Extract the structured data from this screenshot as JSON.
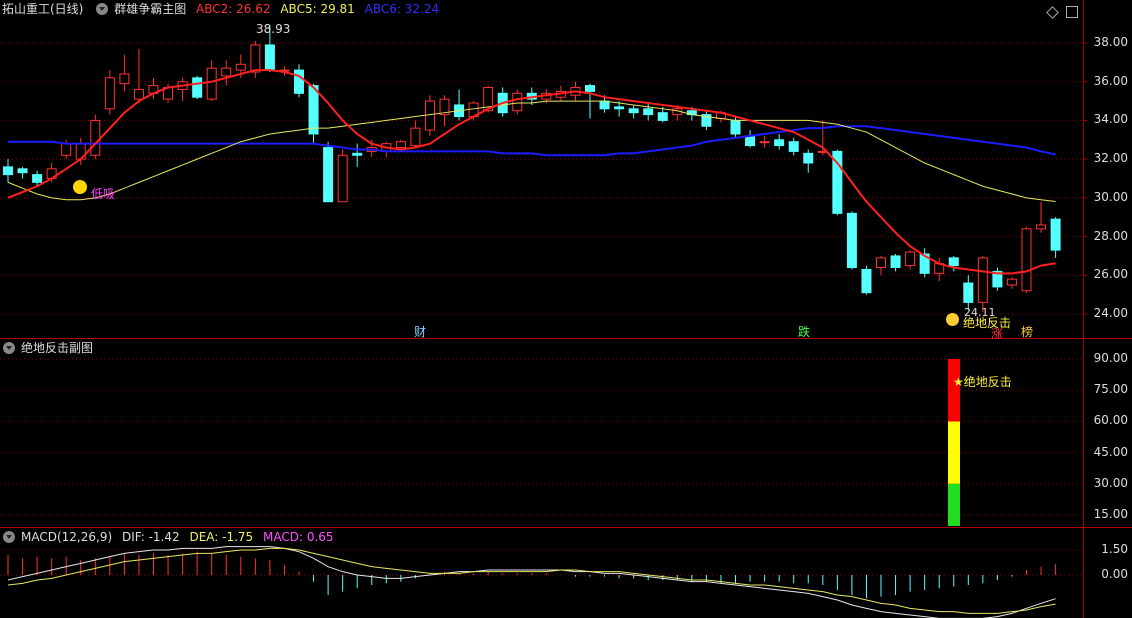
{
  "main": {
    "title": "拓山重工(日线)",
    "indicator": "群雄争霸主图",
    "abc2_label": "ABC2: 26.62",
    "abc5_label": "ABC5: 29.81",
    "abc6_label": "ABC6: 32.24",
    "high_mark": "38.93",
    "low_mark": "24.11",
    "dixi_label": "低吸",
    "juedi_label": "绝地反击",
    "cai_label": "财",
    "die_label": "跌",
    "zhang_label": "涨",
    "bang_label": "榜",
    "y_ticks": [
      "38.00",
      "36.00",
      "34.00",
      "32.00",
      "30.00",
      "28.00",
      "26.00",
      "24.00"
    ]
  },
  "sub": {
    "title": "绝地反击副图",
    "signal_label": "★绝地反击",
    "y_ticks": [
      "90.00",
      "75.00",
      "60.00",
      "45.00",
      "30.00",
      "15.00"
    ]
  },
  "macd": {
    "title": "MACD(12,26,9)",
    "dif": "DIF: -1.42",
    "dea": "DEA: -1.75",
    "macd": "MACD: 0.65",
    "y_ticks": [
      "1.50",
      "0.00"
    ]
  },
  "colors": {
    "up": "#ff3232",
    "down": "#54ffff",
    "abc2": "#ff2020",
    "abc5": "#e8e860",
    "abc6": "#1c1cff",
    "macd_label": "#ff50ff",
    "grid": "#8c0000"
  },
  "chart_data": {
    "type": "candlestick",
    "price_range": [
      23.4,
      39.8
    ],
    "candles": [
      [
        31.6,
        31.2,
        32.0,
        30.8
      ],
      [
        31.5,
        31.3,
        31.6,
        31.0
      ],
      [
        31.2,
        30.8,
        31.4,
        30.6
      ],
      [
        31.0,
        31.5,
        31.8,
        30.8
      ],
      [
        32.2,
        32.8,
        33.0,
        32.0
      ],
      [
        32.0,
        32.8,
        33.1,
        31.7
      ],
      [
        32.2,
        34.0,
        34.3,
        32.0
      ],
      [
        34.6,
        36.2,
        36.6,
        34.3
      ],
      [
        35.9,
        36.4,
        37.4,
        35.5
      ],
      [
        35.1,
        35.6,
        37.7,
        34.9
      ],
      [
        35.4,
        35.8,
        36.2,
        35.1
      ],
      [
        35.1,
        35.7,
        35.9,
        34.9
      ],
      [
        35.6,
        36.0,
        36.2,
        35.0
      ],
      [
        36.2,
        35.2,
        36.3,
        35.1
      ],
      [
        35.1,
        36.7,
        37.1,
        35.0
      ],
      [
        36.3,
        36.7,
        37.1,
        35.8
      ],
      [
        36.6,
        36.9,
        37.4,
        36.2
      ],
      [
        36.5,
        37.9,
        38.1,
        36.2
      ],
      [
        37.9,
        36.6,
        38.9,
        36.5
      ],
      [
        36.6,
        36.6,
        36.8,
        36.3
      ],
      [
        36.6,
        35.4,
        36.9,
        35.2
      ],
      [
        35.8,
        33.3,
        35.9,
        32.8
      ],
      [
        32.6,
        29.8,
        32.9,
        29.8
      ],
      [
        29.8,
        32.2,
        32.5,
        29.8
      ],
      [
        32.3,
        32.2,
        32.8,
        31.6
      ],
      [
        32.4,
        32.6,
        33.0,
        32.1
      ],
      [
        32.4,
        32.8,
        32.9,
        32.1
      ],
      [
        32.6,
        32.9,
        33.0,
        32.4
      ],
      [
        32.7,
        33.6,
        34.0,
        32.6
      ],
      [
        33.5,
        35.0,
        35.3,
        33.2
      ],
      [
        34.3,
        35.1,
        35.3,
        33.7
      ],
      [
        34.8,
        34.2,
        35.6,
        34.0
      ],
      [
        34.2,
        34.9,
        35.0,
        34.0
      ],
      [
        34.5,
        35.7,
        35.8,
        34.4
      ],
      [
        35.4,
        34.4,
        35.7,
        34.2
      ],
      [
        34.5,
        35.4,
        35.6,
        34.3
      ],
      [
        35.4,
        35.1,
        35.7,
        34.8
      ],
      [
        35.1,
        35.4,
        35.6,
        34.9
      ],
      [
        35.2,
        35.5,
        35.8,
        35.0
      ],
      [
        35.3,
        35.7,
        36.0,
        35.0
      ],
      [
        35.8,
        35.5,
        35.9,
        34.1
      ],
      [
        35.0,
        34.6,
        35.3,
        34.4
      ],
      [
        34.7,
        34.6,
        35.0,
        34.2
      ],
      [
        34.6,
        34.4,
        34.8,
        34.1
      ],
      [
        34.6,
        34.3,
        34.9,
        34.0
      ],
      [
        34.4,
        34.0,
        34.7,
        33.9
      ],
      [
        34.3,
        34.6,
        34.8,
        34.0
      ],
      [
        34.5,
        34.3,
        34.7,
        34.0
      ],
      [
        34.3,
        33.7,
        34.5,
        33.5
      ],
      [
        34.1,
        34.4,
        34.5,
        33.9
      ],
      [
        34.0,
        33.3,
        34.2,
        33.1
      ],
      [
        33.2,
        32.7,
        33.5,
        32.6
      ],
      [
        32.9,
        32.9,
        33.2,
        32.6
      ],
      [
        33.0,
        32.7,
        33.3,
        32.5
      ],
      [
        32.9,
        32.4,
        33.1,
        32.2
      ],
      [
        32.3,
        31.8,
        32.5,
        31.3
      ],
      [
        32.4,
        32.4,
        34.0,
        32.2
      ],
      [
        32.4,
        29.2,
        32.5,
        29.1
      ],
      [
        29.2,
        26.4,
        29.3,
        26.3
      ],
      [
        26.3,
        25.1,
        26.5,
        25.0
      ],
      [
        26.4,
        26.9,
        27.0,
        26.0
      ],
      [
        27.0,
        26.4,
        27.1,
        26.2
      ],
      [
        26.5,
        27.2,
        27.3,
        26.3
      ],
      [
        27.1,
        26.1,
        27.4,
        25.9
      ],
      [
        26.1,
        26.6,
        26.9,
        25.7
      ],
      [
        26.9,
        26.5,
        27.0,
        26.2
      ],
      [
        25.6,
        24.6,
        26.0,
        24.2
      ],
      [
        24.6,
        26.9,
        27.0,
        24.1
      ],
      [
        26.2,
        25.4,
        26.4,
        25.2
      ],
      [
        25.5,
        25.8,
        25.9,
        25.3
      ],
      [
        25.2,
        28.4,
        28.5,
        25.1
      ],
      [
        28.4,
        28.6,
        29.8,
        28.2
      ],
      [
        28.9,
        27.3,
        29.0,
        26.9
      ]
    ],
    "ma_abc2": [
      30.0,
      30.3,
      30.6,
      31.0,
      31.5,
      32.0,
      32.8,
      33.6,
      34.4,
      35.0,
      35.4,
      35.7,
      35.8,
      35.9,
      36.0,
      36.2,
      36.4,
      36.6,
      36.6,
      36.5,
      36.3,
      35.7,
      34.9,
      34.0,
      33.3,
      32.8,
      32.6,
      32.5,
      32.6,
      32.8,
      33.3,
      33.8,
      34.2,
      34.6,
      34.9,
      35.1,
      35.2,
      35.3,
      35.4,
      35.5,
      35.4,
      35.2,
      35.1,
      35.0,
      34.9,
      34.8,
      34.7,
      34.6,
      34.5,
      34.4,
      34.2,
      34.0,
      33.8,
      33.6,
      33.4,
      33.0,
      32.6,
      31.8,
      30.8,
      29.8,
      29.0,
      28.2,
      27.5,
      27.0,
      26.6,
      26.4,
      26.3,
      26.2,
      26.1,
      26.1,
      26.2,
      26.5,
      26.62
    ],
    "ma_abc5": [
      30.8,
      30.5,
      30.2,
      30.0,
      29.9,
      29.9,
      30.0,
      30.2,
      30.5,
      30.8,
      31.1,
      31.4,
      31.7,
      32.0,
      32.3,
      32.6,
      32.9,
      33.1,
      33.3,
      33.4,
      33.5,
      33.6,
      33.6,
      33.7,
      33.8,
      33.9,
      34.0,
      34.1,
      34.2,
      34.3,
      34.4,
      34.5,
      34.6,
      34.7,
      34.8,
      34.9,
      34.9,
      35.0,
      35.0,
      35.0,
      35.0,
      35.0,
      34.9,
      34.8,
      34.7,
      34.6,
      34.5,
      34.3,
      34.2,
      34.1,
      34.0,
      34.0,
      34.0,
      34.0,
      34.0,
      34.0,
      33.9,
      33.8,
      33.6,
      33.4,
      33.0,
      32.6,
      32.2,
      31.8,
      31.5,
      31.2,
      30.9,
      30.6,
      30.4,
      30.2,
      30.0,
      29.9,
      29.81
    ],
    "ma_abc6": [
      32.9,
      32.9,
      32.9,
      32.9,
      32.8,
      32.8,
      32.8,
      32.8,
      32.8,
      32.8,
      32.8,
      32.8,
      32.8,
      32.8,
      32.8,
      32.8,
      32.8,
      32.8,
      32.8,
      32.8,
      32.8,
      32.8,
      32.7,
      32.6,
      32.5,
      32.5,
      32.4,
      32.4,
      32.4,
      32.4,
      32.4,
      32.4,
      32.4,
      32.4,
      32.3,
      32.3,
      32.3,
      32.2,
      32.2,
      32.2,
      32.2,
      32.2,
      32.3,
      32.3,
      32.4,
      32.5,
      32.6,
      32.7,
      32.9,
      33.0,
      33.1,
      33.2,
      33.3,
      33.4,
      33.5,
      33.6,
      33.6,
      33.7,
      33.7,
      33.7,
      33.6,
      33.5,
      33.4,
      33.3,
      33.2,
      33.1,
      33.0,
      32.9,
      32.8,
      32.7,
      32.6,
      32.4,
      32.24
    ],
    "sub_bars": [
      {
        "from": 15,
        "to": 30,
        "color": "#22dd22"
      },
      {
        "from": 30,
        "to": 60,
        "color": "#ffff00"
      },
      {
        "from": 60,
        "to": 90,
        "color": "#ff0000"
      }
    ],
    "macd_hist": [
      1.2,
      1.0,
      1.1,
      1.0,
      1.1,
      0.9,
      1.0,
      1.1,
      1.3,
      1.2,
      1.3,
      1.2,
      1.3,
      1.4,
      1.3,
      1.2,
      1.1,
      1.0,
      0.9,
      0.6,
      0.2,
      -0.4,
      -1.2,
      -1.0,
      -0.8,
      -0.6,
      -0.5,
      -0.4,
      -0.2,
      0.1,
      0.2,
      0.1,
      0.1,
      0.2,
      0.1,
      0.1,
      0.1,
      0.1,
      0.0,
      -0.1,
      -0.1,
      -0.1,
      -0.2,
      -0.2,
      -0.3,
      -0.3,
      -0.3,
      -0.4,
      -0.4,
      -0.5,
      -0.5,
      -0.4,
      -0.4,
      -0.4,
      -0.5,
      -0.5,
      -0.6,
      -0.9,
      -1.2,
      -1.4,
      -1.3,
      -1.2,
      -1.0,
      -0.9,
      -0.8,
      -0.7,
      -0.6,
      -0.5,
      -0.3,
      -0.1,
      0.3,
      0.5,
      0.65
    ],
    "dif": [
      -0.3,
      -0.1,
      0.1,
      0.3,
      0.5,
      0.7,
      0.9,
      1.1,
      1.3,
      1.4,
      1.5,
      1.5,
      1.6,
      1.6,
      1.6,
      1.7,
      1.7,
      1.7,
      1.7,
      1.6,
      1.4,
      1.0,
      0.5,
      0.2,
      0.0,
      -0.1,
      -0.2,
      -0.2,
      -0.1,
      0.0,
      0.1,
      0.2,
      0.2,
      0.3,
      0.3,
      0.3,
      0.3,
      0.3,
      0.3,
      0.2,
      0.2,
      0.1,
      0.1,
      0.0,
      -0.1,
      -0.2,
      -0.3,
      -0.4,
      -0.4,
      -0.5,
      -0.6,
      -0.7,
      -0.8,
      -0.9,
      -1.0,
      -1.1,
      -1.3,
      -1.5,
      -1.8,
      -2.0,
      -2.2,
      -2.3,
      -2.4,
      -2.5,
      -2.6,
      -2.6,
      -2.6,
      -2.6,
      -2.5,
      -2.3,
      -2.0,
      -1.7,
      -1.42
    ],
    "dea": [
      -0.6,
      -0.5,
      -0.3,
      -0.2,
      0.0,
      0.2,
      0.4,
      0.6,
      0.8,
      0.9,
      1.0,
      1.1,
      1.2,
      1.3,
      1.3,
      1.4,
      1.5,
      1.5,
      1.6,
      1.6,
      1.5,
      1.3,
      1.1,
      0.9,
      0.7,
      0.5,
      0.4,
      0.3,
      0.2,
      0.1,
      0.1,
      0.1,
      0.2,
      0.2,
      0.2,
      0.2,
      0.2,
      0.2,
      0.3,
      0.3,
      0.2,
      0.2,
      0.2,
      0.1,
      0.0,
      -0.1,
      -0.2,
      -0.3,
      -0.3,
      -0.4,
      -0.5,
      -0.6,
      -0.6,
      -0.7,
      -0.8,
      -0.9,
      -1.0,
      -1.2,
      -1.3,
      -1.5,
      -1.7,
      -1.8,
      -2.0,
      -2.1,
      -2.2,
      -2.2,
      -2.3,
      -2.3,
      -2.3,
      -2.2,
      -2.1,
      -1.9,
      -1.75
    ]
  }
}
